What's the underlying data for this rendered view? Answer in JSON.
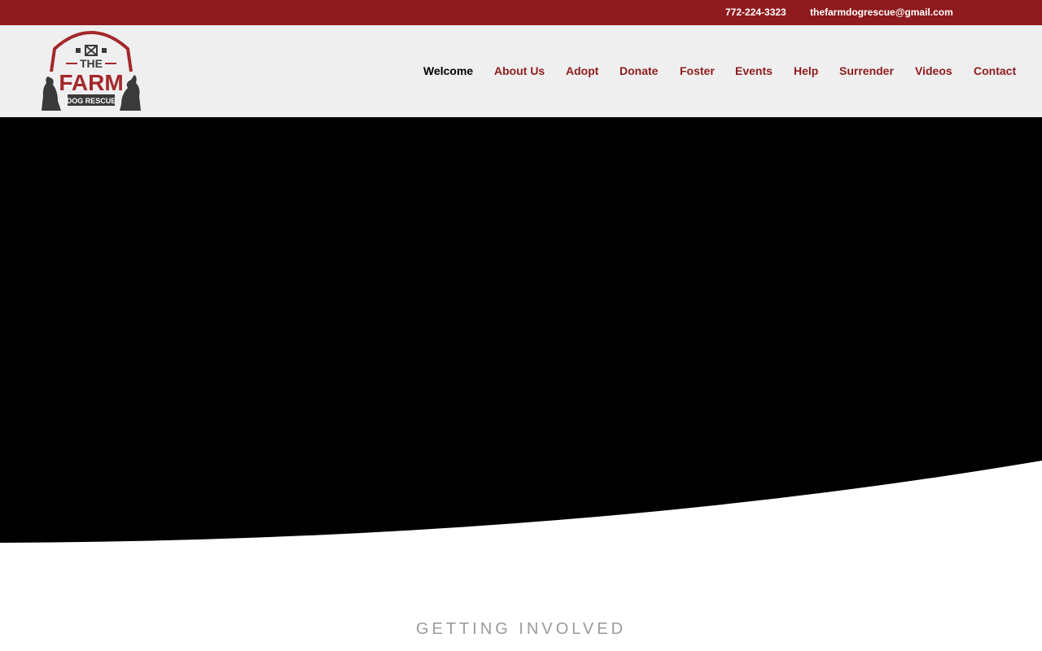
{
  "topbar": {
    "phone": "772-224-3323",
    "email": "thefarmdogrescue@gmail.com"
  },
  "logo": {
    "text_the": "THE",
    "text_farm": "FARM",
    "text_sub": "DOG RESCUE",
    "colors": {
      "red": "#a3282b",
      "dark": "#3a3a3a"
    }
  },
  "nav": {
    "items": [
      {
        "label": "Welcome",
        "active": true
      },
      {
        "label": "About Us"
      },
      {
        "label": "Adopt"
      },
      {
        "label": "Donate"
      },
      {
        "label": "Foster"
      },
      {
        "label": "Events"
      },
      {
        "label": "Help"
      },
      {
        "label": "Surrender"
      },
      {
        "label": "Videos"
      },
      {
        "label": "Contact"
      }
    ]
  },
  "section": {
    "title": "GETTING INVOLVED"
  },
  "colors": {
    "brand": "#8e1b1e",
    "header_bg": "#efefef",
    "hero_bg": "#000000",
    "section_title": "#9a9a9a"
  }
}
